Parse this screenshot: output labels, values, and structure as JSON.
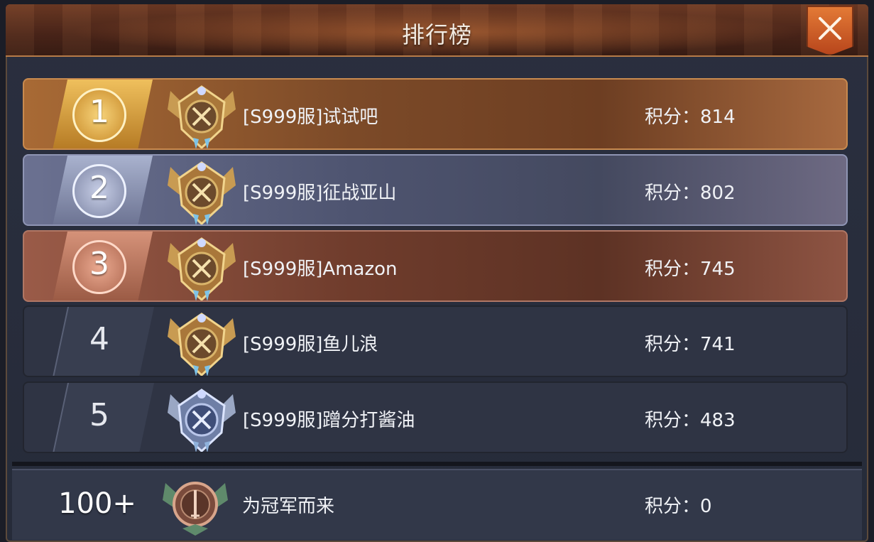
{
  "header": {
    "title": "排行榜"
  },
  "close_icon": "close-x-icon",
  "colors": {
    "gold": "#c88a4f",
    "silver": "#8f95b4",
    "bronze": "#b07765",
    "close_button": "#d8642a"
  },
  "rows": [
    {
      "rank": "1",
      "name": "[S999服]试试吧",
      "score": "积分：814",
      "emblem": "gold-winged-emblem-icon"
    },
    {
      "rank": "2",
      "name": "[S999服]征战亚山",
      "score": "积分：802",
      "emblem": "gold-winged-emblem-icon"
    },
    {
      "rank": "3",
      "name": "[S999服]Amazon",
      "score": "积分：745",
      "emblem": "gold-winged-emblem-icon"
    },
    {
      "rank": "4",
      "name": "[S999服]鱼儿浪",
      "score": "积分：741",
      "emblem": "gold-winged-emblem-icon"
    },
    {
      "rank": "5",
      "name": "[S999服]蹭分打酱油",
      "score": "积分：483",
      "emblem": "silver-winged-emblem-icon"
    }
  ],
  "self_row": {
    "rank": "100+",
    "name": "为冠军而来",
    "score": "积分：0",
    "emblem": "bronze-sword-emblem-icon"
  }
}
